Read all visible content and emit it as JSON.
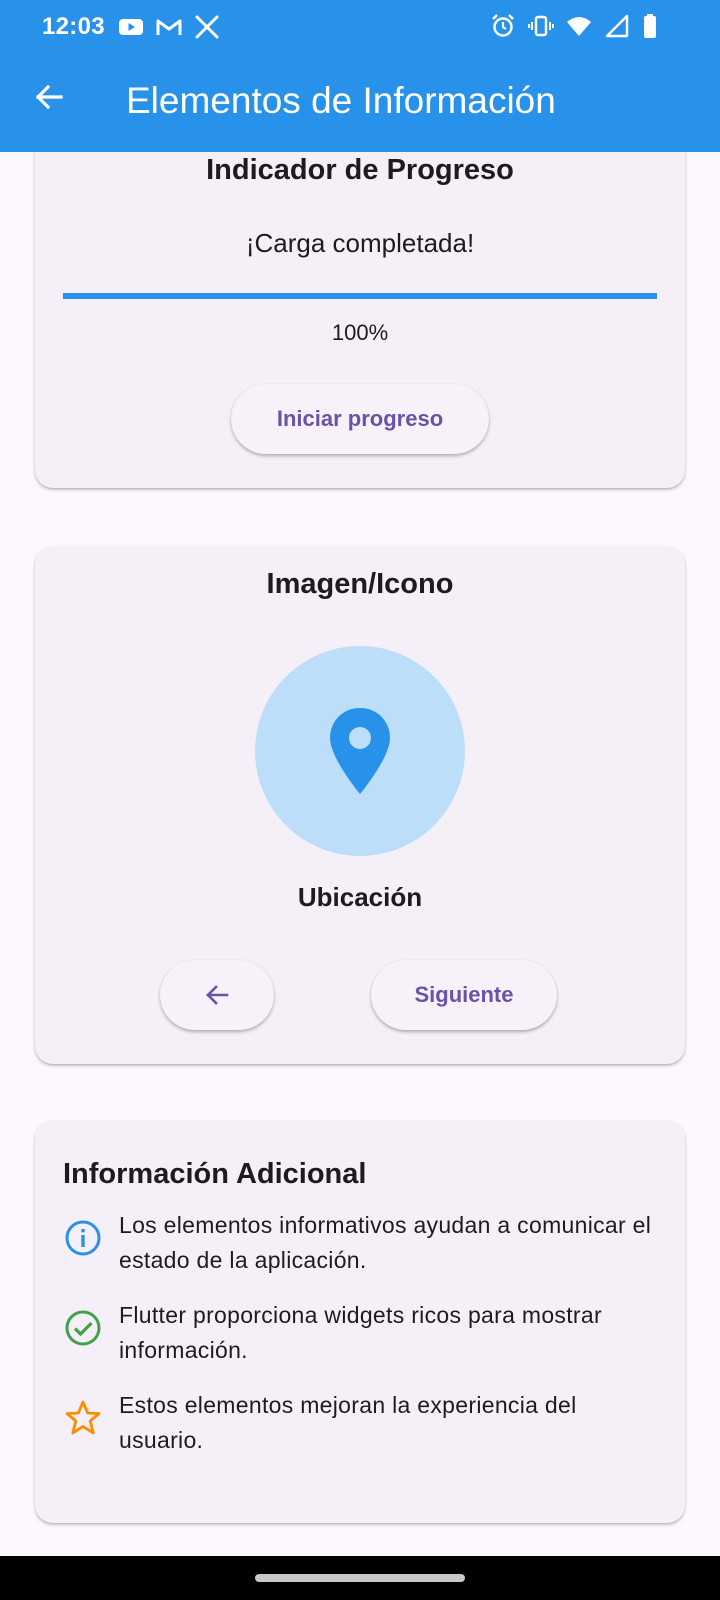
{
  "status_bar": {
    "time": "12:03",
    "left_icons": [
      "youtube-icon",
      "gmail-icon",
      "x-icon"
    ],
    "right_icons": [
      "alarm-icon",
      "vibrate-icon",
      "wifi-icon",
      "signal-icon",
      "battery-icon"
    ]
  },
  "app_bar": {
    "title": "Elementos de Información",
    "back_icon": "arrow-back-icon",
    "background": "#2892ea"
  },
  "progress_card": {
    "title": "Indicador de Progreso",
    "message": "¡Carga completada!",
    "progress": 1.0,
    "percent_label": "100%",
    "button_label": "Iniciar progreso",
    "bar_color": "#2892ea"
  },
  "image_card": {
    "title": "Imagen/Icono",
    "icon": "location-pin-icon",
    "caption": "Ubicación",
    "prev_icon": "arrow-back-icon",
    "next_label": "Siguiente",
    "circle_color": "#bcdef9"
  },
  "info_card": {
    "title": "Información Adicional",
    "items": [
      {
        "icon": "info-icon",
        "color": "#2892ea",
        "text": "Los elementos informativos ayudan a comunicar el estado de la aplicación."
      },
      {
        "icon": "check-circle-icon",
        "color": "#43a047",
        "text": "Flutter proporciona widgets ricos para mostrar información."
      },
      {
        "icon": "star-outline-icon",
        "color": "#fb8c00",
        "text": "Estos elementos mejoran la experiencia del usuario."
      }
    ]
  },
  "colors": {
    "accent": "#2892ea",
    "button_text": "#6a52a6",
    "background": "#fdf7ff",
    "card": "#f5f0f7"
  }
}
